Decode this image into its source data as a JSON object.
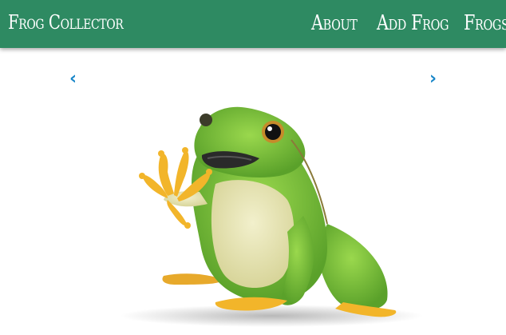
{
  "navbar": {
    "brand": "Frog Collector",
    "links": {
      "about": "About",
      "add_frog": "Add Frog",
      "frogs": "Frogs"
    }
  },
  "carousel": {
    "prev_label": "‹",
    "next_label": "›",
    "image_subject": "green tree frog"
  },
  "colors": {
    "navbar_bg": "#2e8a62",
    "nav_text": "#ffffff",
    "arrow": "#1a87c9",
    "frog_green": "#7cc63b",
    "frog_belly": "#e8e6b8",
    "frog_toes": "#f2b52a"
  }
}
